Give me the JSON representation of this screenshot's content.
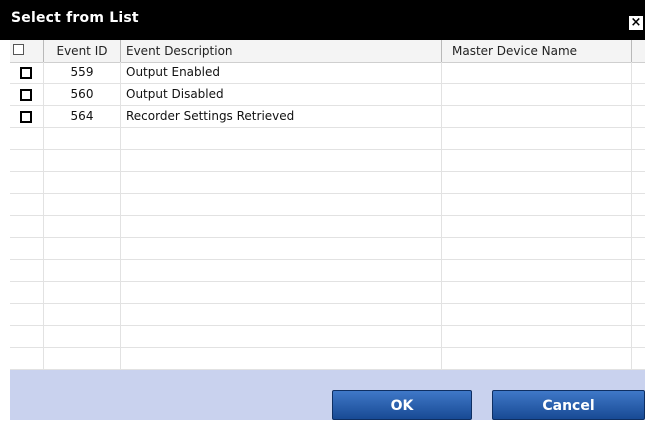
{
  "dialog": {
    "title": "Select from List",
    "close_glyph": "×"
  },
  "columns": [
    "Event ID",
    "Event Description",
    "Master Device Name"
  ],
  "rows": [
    {
      "checked": false,
      "event_id": "559",
      "description": "Output Enabled",
      "device": ""
    },
    {
      "checked": false,
      "event_id": "560",
      "description": "Output Disabled",
      "device": ""
    },
    {
      "checked": false,
      "event_id": "564",
      "description": "Recorder Settings Retrieved",
      "device": ""
    }
  ],
  "buttons": {
    "ok": "OK",
    "cancel": "Cancel"
  },
  "colors": {
    "titlebar": "#000000",
    "footer": "#c9d2ee",
    "button": "#2a5fb0"
  }
}
